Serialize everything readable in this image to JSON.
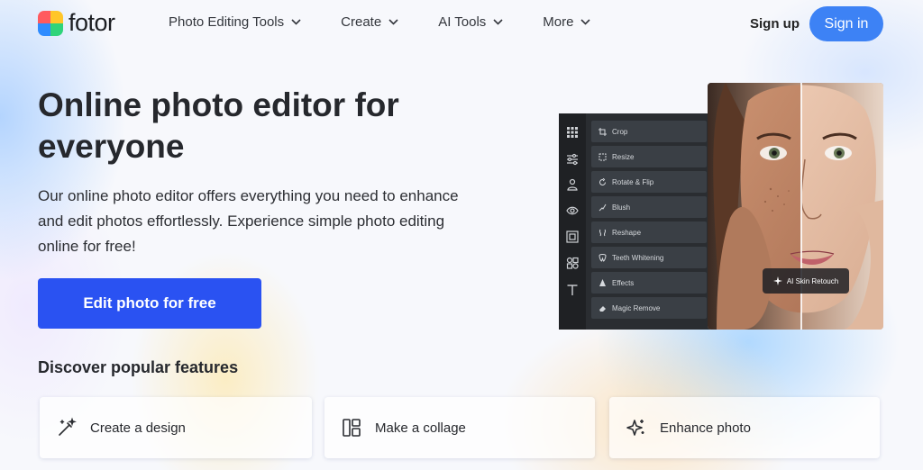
{
  "header": {
    "logo_text": "fotor",
    "nav": [
      {
        "label": "Photo Editing Tools"
      },
      {
        "label": "Create"
      },
      {
        "label": "AI Tools"
      },
      {
        "label": "More"
      }
    ],
    "signup_label": "Sign up",
    "signin_label": "Sign in"
  },
  "hero": {
    "title": "Online photo editor for everyone",
    "description": "Our online photo editor offers everything you need to enhance and edit photos effortlessly. Experience simple photo editing online for free!",
    "cta_label": "Edit photo for free"
  },
  "editor": {
    "side_tools": [
      "grid-icon",
      "sliders-icon",
      "person-icon",
      "eye-icon",
      "frame-icon",
      "shapes-icon",
      "text-icon"
    ],
    "menu": [
      {
        "label": "Crop",
        "icon": "crop-icon"
      },
      {
        "label": "Resize",
        "icon": "resize-icon"
      },
      {
        "label": "Rotate & Flip",
        "icon": "rotate-icon"
      },
      {
        "label": "Blush",
        "icon": "blush-icon"
      },
      {
        "label": "Reshape",
        "icon": "reshape-icon"
      },
      {
        "label": "Teeth Whitening",
        "icon": "teeth-icon"
      },
      {
        "label": "Effects",
        "icon": "effects-icon"
      },
      {
        "label": "Magic Remove",
        "icon": "eraser-icon"
      }
    ],
    "badge_label": "AI Skin Retouch"
  },
  "features": {
    "title": "Discover popular features",
    "cards": [
      {
        "label": "Create a design",
        "icon": "magic-wand-icon"
      },
      {
        "label": "Make a collage",
        "icon": "collage-icon"
      },
      {
        "label": "Enhance photo",
        "icon": "sparkle-icon"
      }
    ]
  },
  "colors": {
    "primary_button": "#2a52f2",
    "signin_button": "#3d82f5",
    "text": "#26282d"
  }
}
